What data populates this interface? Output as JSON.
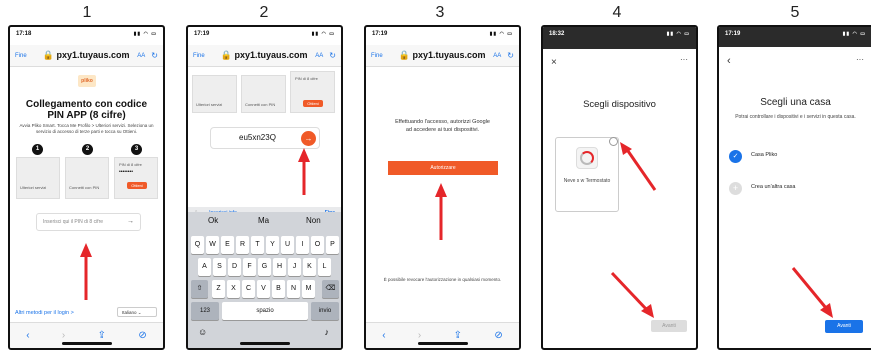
{
  "steps": [
    "1",
    "2",
    "3",
    "4",
    "5"
  ],
  "browser": {
    "done": "Fine",
    "url": "pxy1.tuyaus.com",
    "aa": "AA"
  },
  "screen1": {
    "time": "17:18",
    "logo": "pliko",
    "title": "Collegamento con codice PIN APP (8 cifre)",
    "desc": "Avvia Pliko Smart. Tocca Me Profilo > Ulteriori servizi. Seleziona un servizio di accesso di terze parti e tocca su Ottieni.",
    "step_nums": [
      "1",
      "2",
      "3"
    ],
    "mini_labels": [
      "Ulteriori servizi",
      "Connetti con PIN",
      "PIN di 8 cifre",
      "••••••••",
      "Ottieni"
    ],
    "pin_placeholder": "Inserisci qui il PIN di 8 cifre",
    "other_login": "Altri metodi per il login >",
    "language": "Italiano"
  },
  "screen2": {
    "time": "17:19",
    "pin": "eu5xn23Q",
    "accessory_label": "Inserisci info",
    "accessory_done": "Fine",
    "suggestions": [
      "Ok",
      "Ma",
      "Non"
    ],
    "row1": [
      "Q",
      "W",
      "E",
      "R",
      "T",
      "Y",
      "U",
      "I",
      "O",
      "P"
    ],
    "row2": [
      "A",
      "S",
      "D",
      "F",
      "G",
      "H",
      "J",
      "K",
      "L"
    ],
    "row3": [
      "Z",
      "X",
      "C",
      "V",
      "B",
      "N",
      "M"
    ],
    "num_key": "123",
    "space_key": "spazio",
    "enter_key": "invio"
  },
  "screen3": {
    "time": "17:19",
    "message": "Effettuando l'accesso, autorizzi Google ad accedere ai tuoi dispositivi.",
    "authorize": "Autorizzare",
    "revoke": "È possibile revocare l'autorizzazione in qualsiasi momento."
  },
  "screen4": {
    "time": "18:32",
    "title": "Scegli dispositivo",
    "device_name": "Neve s w Termostato",
    "next": "Avanti"
  },
  "screen5": {
    "time": "17:19",
    "title": "Scegli una casa",
    "subtitle": "Potrai controllare i dispositivi e i servizi in questa casa.",
    "home1": "Casa Pliko",
    "home2": "Crea un'altra casa",
    "next": "Avanti"
  },
  "colors": {
    "accent_orange": "#f05a28",
    "link_blue": "#1a73e8",
    "google_blue": "#1a73e8",
    "arrow_red": "#e5262a"
  }
}
